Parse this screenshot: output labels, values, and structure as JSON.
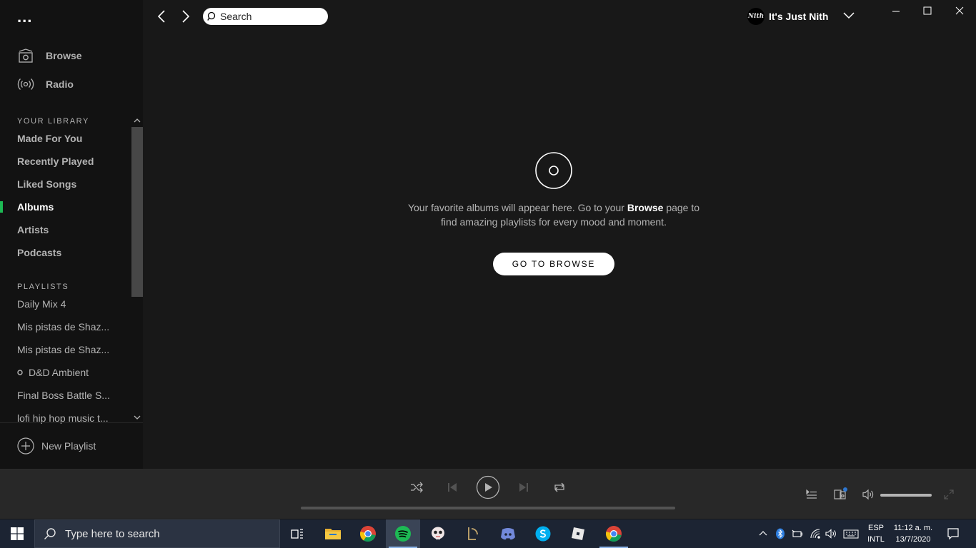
{
  "sidebar": {
    "menu_dots": "...",
    "nav": [
      {
        "label": "Browse",
        "icon": "browse-icon"
      },
      {
        "label": "Radio",
        "icon": "radio-icon"
      }
    ],
    "library_title": "YOUR LIBRARY",
    "library": [
      {
        "label": "Made For You",
        "active": false
      },
      {
        "label": "Recently Played",
        "active": false
      },
      {
        "label": "Liked Songs",
        "active": false
      },
      {
        "label": "Albums",
        "active": true
      },
      {
        "label": "Artists",
        "active": false
      },
      {
        "label": "Podcasts",
        "active": false
      }
    ],
    "playlists_title": "PLAYLISTS",
    "playlists": [
      "Daily Mix 4",
      "Mis pistas de Shaz...",
      "Mis pistas de Shaz...",
      "D&D Ambient",
      "Final Boss Battle S...",
      "lofi hip hop music t..."
    ],
    "new_playlist": "New Playlist"
  },
  "topbar": {
    "search_placeholder": "Search",
    "user_name": "It's Just Nith",
    "avatar_text": "Nith"
  },
  "main": {
    "empty_text_before": "Your favorite albums will appear here. Go to your",
    "empty_text_bold": "Browse",
    "empty_text_after": "page to find amazing playlists for every mood and moment.",
    "button_label": "GO TO BROWSE"
  },
  "player": {
    "progress": 0,
    "volume": 1.0
  },
  "taskbar": {
    "search_placeholder": "Type here to search",
    "apps": [
      "task-view-icon",
      "file-explorer-icon",
      "chrome-icon",
      "spotify-icon",
      "game-skull-icon",
      "league-icon",
      "discord-icon",
      "skype-icon",
      "roblox-icon",
      "chrome-icon"
    ],
    "active_app": "spotify-icon",
    "lang_line1": "ESP",
    "lang_line2": "INTL",
    "time": "11:12 a. m.",
    "date": "13/7/2020"
  },
  "colors": {
    "accent": "#1db954",
    "sidebar_bg": "#121212",
    "main_bg": "#181818",
    "player_bg": "#282828",
    "taskbar_bg": "#1c2433"
  }
}
